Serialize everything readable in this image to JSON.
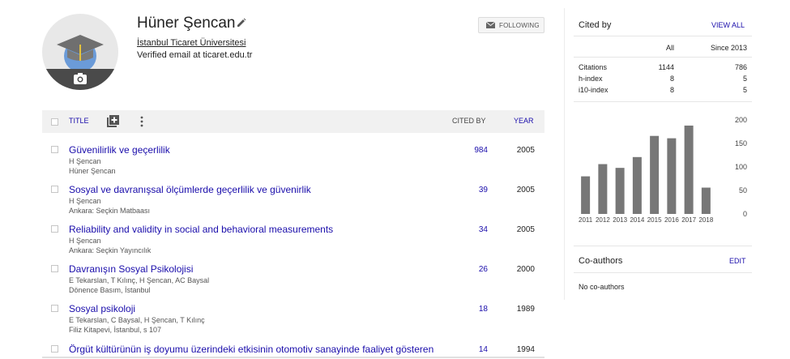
{
  "profile": {
    "name": "Hüner Şencan",
    "affiliation": "İstanbul Ticaret Üniversitesi",
    "email": "Verified email at ticaret.edu.tr",
    "follow_label": "FOLLOWING"
  },
  "table": {
    "title_header": "TITLE",
    "cited_header": "CITED BY",
    "year_header": "YEAR",
    "rows": [
      {
        "title": "Güvenilirlik ve geçerlilik",
        "authors": "H Şencan",
        "venue": "Hüner Şencan",
        "cites": "984",
        "year": "2005"
      },
      {
        "title": "Sosyal ve davranışsal ölçümlerde geçerlilik ve güvenirlik",
        "authors": "H Şencan",
        "venue": "Ankara: Seçkin Matbaası",
        "cites": "39",
        "year": "2005"
      },
      {
        "title": "Reliability and validity in social and behavioral measurements",
        "authors": "H Şencan",
        "venue": "Ankara: Seçkin Yayıncılık",
        "cites": "34",
        "year": "2005"
      },
      {
        "title": "Davranışın Sosyal Psikolojisi",
        "authors": "E Tekarslan, T Kılınç, H Şencan, AC Baysal",
        "venue": "Dönence Basım, İstanbul",
        "cites": "26",
        "year": "2000"
      },
      {
        "title": "Sosyal psikoloji",
        "authors": "E Tekarslan, C Baysal, H Şencan, T Kılınç",
        "venue": "Filiz Kitapevi, İstanbul, s 107",
        "cites": "18",
        "year": "1989"
      },
      {
        "title": "Örgüt kültürünün iş doyumu üzerindeki etkisinin otomotiv sanayinde faaliyet gösteren",
        "authors": "",
        "venue": "",
        "cites": "14",
        "year": "1994"
      }
    ]
  },
  "cited_by": {
    "heading": "Cited by",
    "view_all": "VIEW ALL",
    "col_all": "All",
    "col_since": "Since 2013",
    "stats": [
      {
        "label": "Citations",
        "all": "1144",
        "since": "786"
      },
      {
        "label": "h-index",
        "all": "8",
        "since": "5"
      },
      {
        "label": "i10-index",
        "all": "8",
        "since": "5"
      }
    ]
  },
  "chart_data": {
    "type": "bar",
    "categories": [
      "2011",
      "2012",
      "2013",
      "2014",
      "2015",
      "2016",
      "2017",
      "2018"
    ],
    "values": [
      80,
      106,
      98,
      121,
      166,
      161,
      188,
      56
    ],
    "ylim": [
      0,
      200
    ],
    "yticks": [
      "200",
      "150",
      "100",
      "50",
      "0"
    ],
    "bar_color": "#777777"
  },
  "coauthors": {
    "heading": "Co-authors",
    "edit": "EDIT",
    "empty": "No co-authors"
  }
}
